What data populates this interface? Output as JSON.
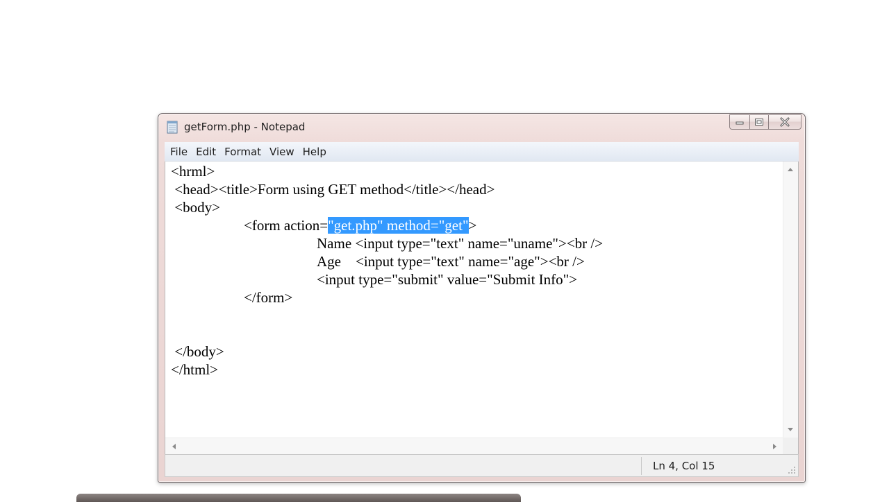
{
  "window": {
    "title": "getForm.php - Notepad"
  },
  "menu": [
    "File",
    "Edit",
    "Format",
    "View",
    "Help"
  ],
  "editor": {
    "lines": [
      {
        "pre": "<hrml>",
        "sel": "",
        "post": ""
      },
      {
        "pre": " <head><title>Form using GET method</title></head>",
        "sel": "",
        "post": ""
      },
      {
        "pre": " <body>",
        "sel": "",
        "post": ""
      },
      {
        "pre": "\t<form action=",
        "sel": "\"get.php\" method=\"get\"",
        "post": ">"
      },
      {
        "pre": "\t\tName <input type=\"text\" name=\"uname\"><br />",
        "sel": "",
        "post": ""
      },
      {
        "pre": "\t\tAge    <input type=\"text\" name=\"age\"><br />",
        "sel": "",
        "post": ""
      },
      {
        "pre": "\t\t<input type=\"submit\" value=\"Submit Info\">",
        "sel": "",
        "post": ""
      },
      {
        "pre": "\t</form>",
        "sel": "",
        "post": ""
      },
      {
        "pre": "",
        "sel": "",
        "post": ""
      },
      {
        "pre": "",
        "sel": "",
        "post": ""
      },
      {
        "pre": " </body>",
        "sel": "",
        "post": ""
      },
      {
        "pre": "</html>",
        "sel": "",
        "post": ""
      }
    ]
  },
  "status": {
    "position": "Ln 4, Col 15"
  },
  "colors": {
    "selection": "#3399ff",
    "frame": "#efdcda",
    "menubar": "#e1e8f2"
  }
}
